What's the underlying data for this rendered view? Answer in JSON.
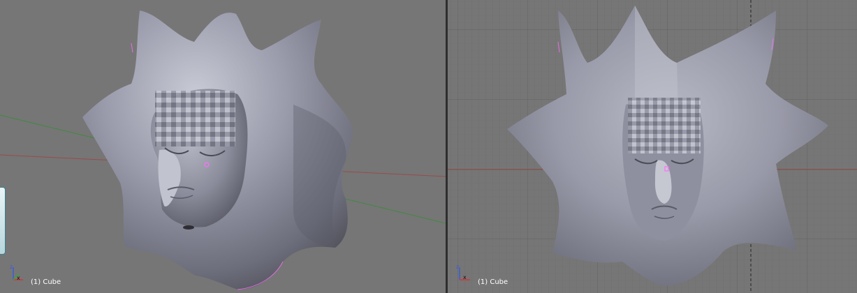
{
  "left_viewport": {
    "object_label": "(1) Cube",
    "view": "user-perspective"
  },
  "right_viewport": {
    "object_label": "(1) Cube",
    "view": "front-orthographic",
    "grid": true
  },
  "colors": {
    "viewport_bg": "#767676",
    "grid_line": "#6b6b6b",
    "x_axis": "#9a4a4a",
    "y_axis": "#3f8a3f",
    "mesh_base": "#8f909f",
    "mesh_light": "#c4c6d1",
    "mesh_shadow": "#4d4e59",
    "origin_point": "#ff6eff"
  },
  "icons": {
    "axis_gizmo": "axis-gizmo-icon",
    "object_origin": "object-origin-icon"
  }
}
